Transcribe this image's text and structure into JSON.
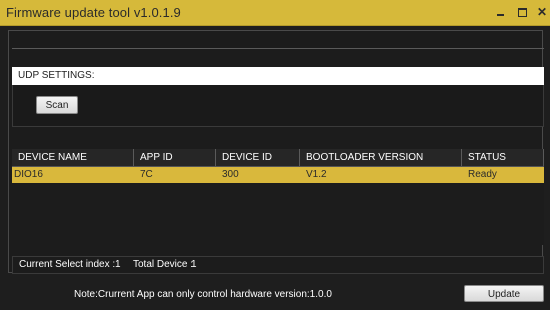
{
  "window": {
    "title": "Firmware update tool v1.0.1.9",
    "minimize_icon": "minimize-icon",
    "maximize_icon": "maximize-icon",
    "close_icon": "close-icon",
    "close_glyph": "✕"
  },
  "udp": {
    "header": "UDP SETTINGS:",
    "scan_label": "Scan"
  },
  "table": {
    "columns": [
      "DEVICE NAME",
      "APP ID",
      "DEVICE ID",
      "BOOTLOADER VERSION",
      "STATUS"
    ],
    "rows": [
      {
        "device_name": "DIO16",
        "app_id": "7C",
        "device_id": "300",
        "bootloader_version": "V1.2",
        "status": "Ready"
      }
    ],
    "selected_row_color": "#d9b83c"
  },
  "status": {
    "current_select_label": "Current Select index :",
    "current_select_value": "1",
    "total_device_label": "Total Device :",
    "total_device_value": "1"
  },
  "footer": {
    "note": "Note:Crurrent App can only control hardware version:1.0.0",
    "update_label": "Update"
  },
  "colors": {
    "accent": "#d6b93a",
    "background": "#1e1e1e"
  }
}
